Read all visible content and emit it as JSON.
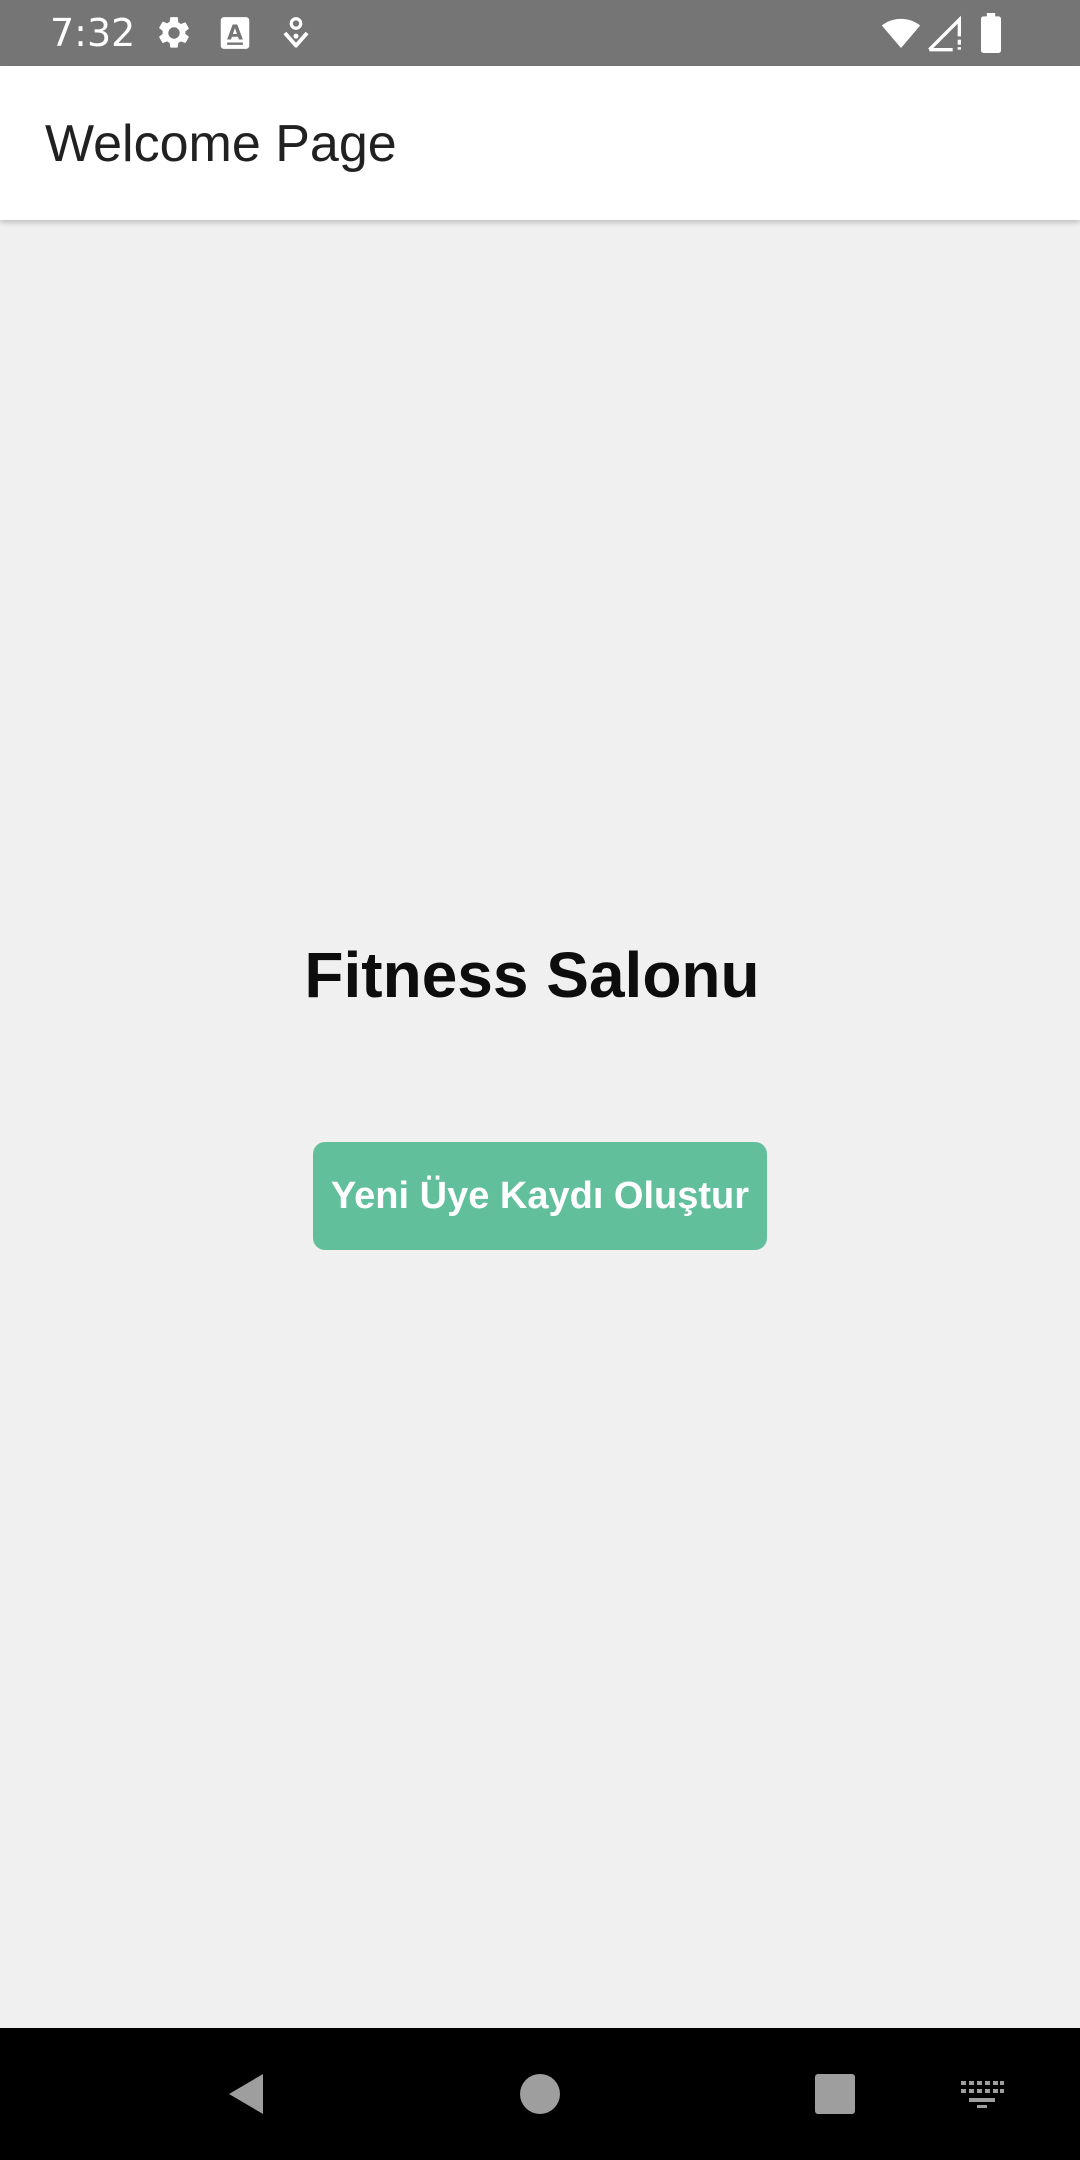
{
  "status_bar": {
    "time": "7:32",
    "background": "#757575",
    "left_icons": [
      "settings-icon",
      "text-a-icon",
      "location-pin-icon"
    ],
    "right_icons": [
      "wifi-icon",
      "cellular-signal-icon",
      "battery-icon"
    ]
  },
  "app_bar": {
    "title": "Welcome Page"
  },
  "main": {
    "headline": "Fitness Salonu",
    "button_label": "Yeni Üye Kaydı Oluştur",
    "button_color": "#62bf9c"
  },
  "nav_bar": {
    "buttons": [
      "back-icon",
      "home-icon",
      "recents-icon",
      "keyboard-icon"
    ]
  }
}
